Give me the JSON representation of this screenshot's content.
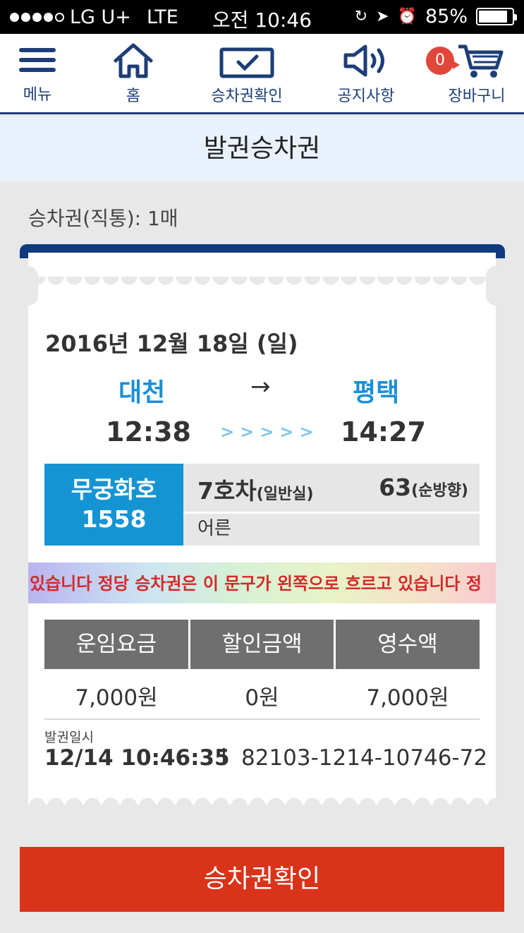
{
  "status_bar": {
    "carrier": "LG U+",
    "network": "LTE",
    "time": "오전 10:46",
    "battery": "85%"
  },
  "nav": {
    "menu_label": "메뉴",
    "home_label": "홈",
    "check_label": "승차권확인",
    "notice_label": "공지사항",
    "cart_label": "장바구니",
    "cart_count": "0"
  },
  "page_title": "발권승차권",
  "ticket_count": "승차권(직통): 1매",
  "ticket": {
    "date": "2016년 12월 18일 (일)",
    "from_station": "대천",
    "to_station": "평택",
    "arrow": "→",
    "depart_time": "12:38",
    "arrive_time": "14:27",
    "chevrons": ">>>>>",
    "train_name": "무궁화호",
    "train_number": "1558",
    "car": "7호차",
    "car_class": "(일반실)",
    "seat": "63",
    "seat_direction": "(순방향)",
    "passenger_type": "어른",
    "marquee_text": "있습니다  정당 승차권은 이 문구가 왼쪽으로 흐르고 있습니다  정",
    "fare_headers": [
      "운임요금",
      "할인금액",
      "영수액"
    ],
    "fare_values": [
      "7,000원",
      "0원",
      "7,000원"
    ],
    "issue_label": "발권일시",
    "issue_time": "12/14 10:46:35",
    "ticket_number": "82103-1214-10746-72"
  },
  "confirm_button": "승차권확인",
  "colors": {
    "navy": "#1d3d77",
    "blue": "#1594d3",
    "red": "#d9331a",
    "marquee_text": "#d12a2a"
  }
}
